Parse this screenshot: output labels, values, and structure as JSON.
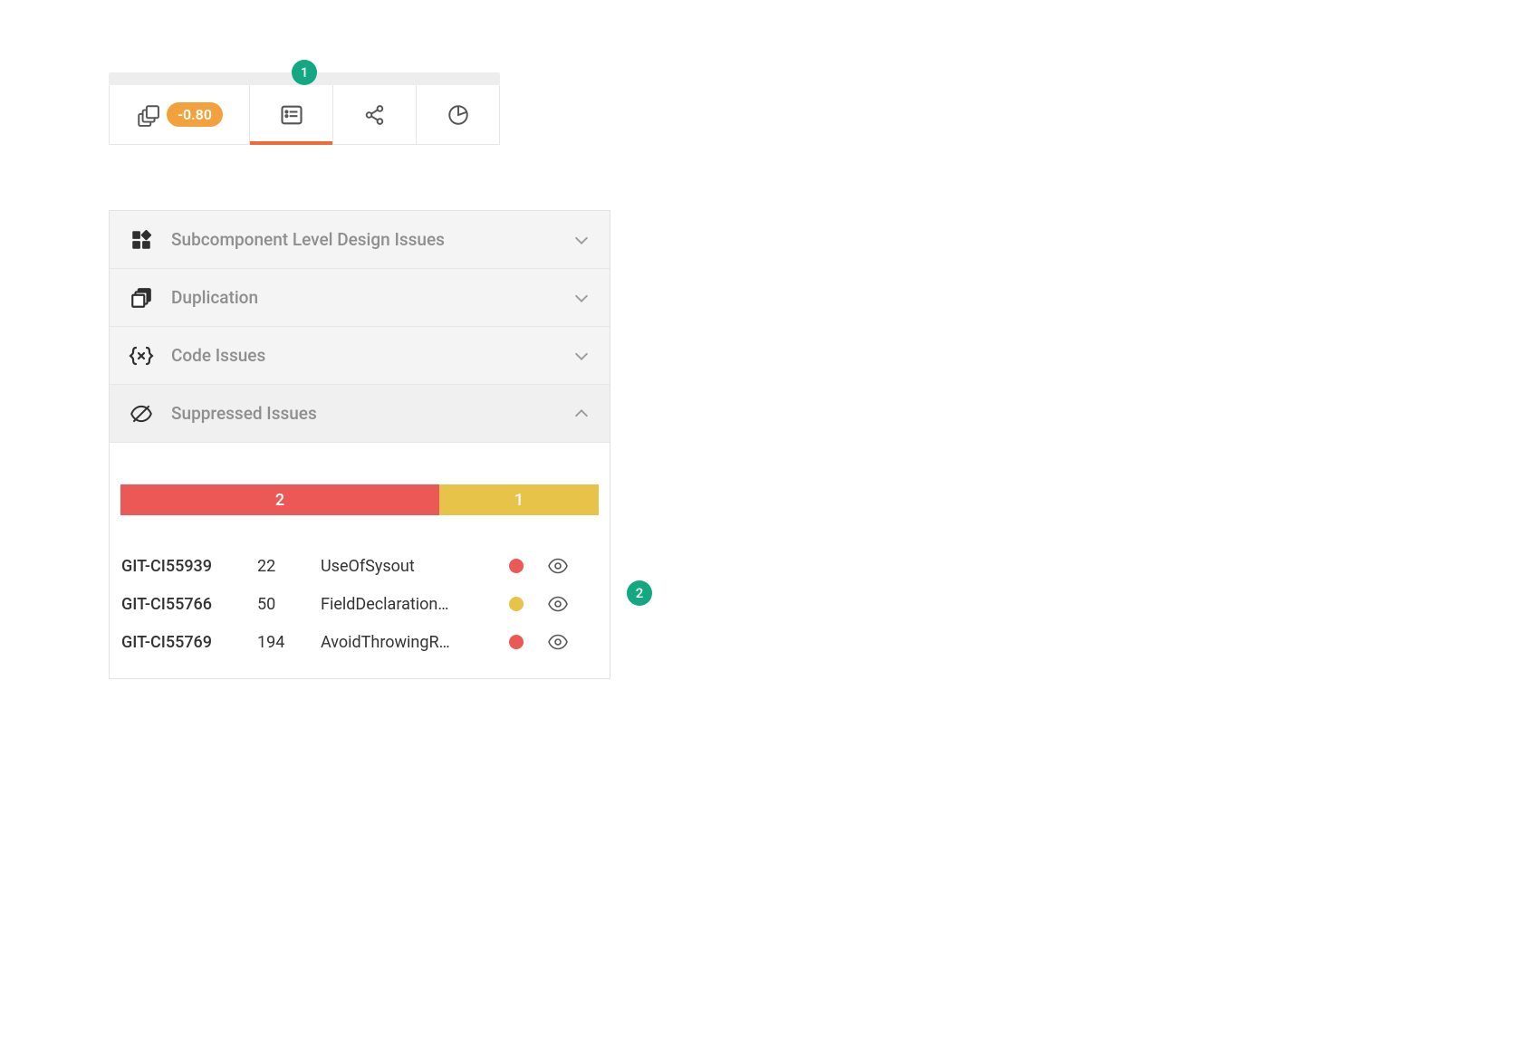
{
  "annotations": {
    "callout1": "1",
    "callout2": "2"
  },
  "tabs": {
    "badge_value": "-0.80",
    "items": [
      {
        "name": "layers",
        "active": false
      },
      {
        "name": "list",
        "active": true
      },
      {
        "name": "graph",
        "active": false
      },
      {
        "name": "chart",
        "active": false
      }
    ]
  },
  "accordion": [
    {
      "key": "design",
      "label": "Subcomponent Level Design Issues",
      "icon": "grid",
      "expanded": false
    },
    {
      "key": "dup",
      "label": "Duplication",
      "icon": "stack",
      "expanded": false
    },
    {
      "key": "code",
      "label": "Code Issues",
      "icon": "brace-x",
      "expanded": false
    },
    {
      "key": "suppressed",
      "label": "Suppressed Issues",
      "icon": "eye-off",
      "expanded": true
    }
  ],
  "severity_bar": [
    {
      "color": "red",
      "count": "2",
      "weight": 2
    },
    {
      "color": "yellow",
      "count": "1",
      "weight": 1
    }
  ],
  "issues": [
    {
      "id": "GIT-CI55939",
      "line": "22",
      "name": "UseOfSysout",
      "severity": "red"
    },
    {
      "id": "GIT-CI55766",
      "line": "50",
      "name": "FieldDeclaration…",
      "severity": "yellow"
    },
    {
      "id": "GIT-CI55769",
      "line": "194",
      "name": "AvoidThrowingR…",
      "severity": "red"
    }
  ]
}
